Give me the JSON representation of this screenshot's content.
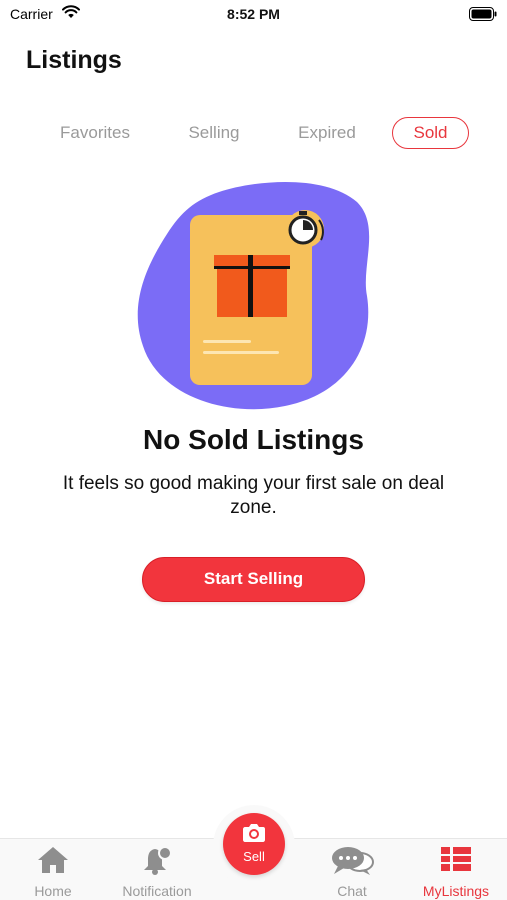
{
  "status_bar": {
    "carrier": "Carrier",
    "time": "8:52 PM"
  },
  "page": {
    "title": "Listings"
  },
  "tabs": [
    {
      "label": "Favorites",
      "active": false
    },
    {
      "label": "Selling",
      "active": false
    },
    {
      "label": "Expired",
      "active": false
    },
    {
      "label": "Sold",
      "active": true
    }
  ],
  "empty_state": {
    "illustration_icon": "gift-box-card-icon",
    "title": "No Sold Listings",
    "description": "It feels so good making your first sale on deal zone.",
    "cta_label": "Start Selling"
  },
  "bottom_nav": {
    "items": [
      {
        "label": "Home",
        "icon": "home-icon",
        "active": false
      },
      {
        "label": "Notification",
        "icon": "bell-icon",
        "active": false
      },
      {
        "label": "Sell",
        "icon": "camera-icon",
        "active": false
      },
      {
        "label": "Chat",
        "icon": "chat-bubbles-icon",
        "active": false
      },
      {
        "label": "MyListings",
        "icon": "list-icon",
        "active": true
      }
    ]
  },
  "colors": {
    "accent": "#f2353d",
    "inactive": "#9a9a9a",
    "blob": "#7b6cf6",
    "card": "#f6c15b",
    "box": "#f15a1c"
  }
}
